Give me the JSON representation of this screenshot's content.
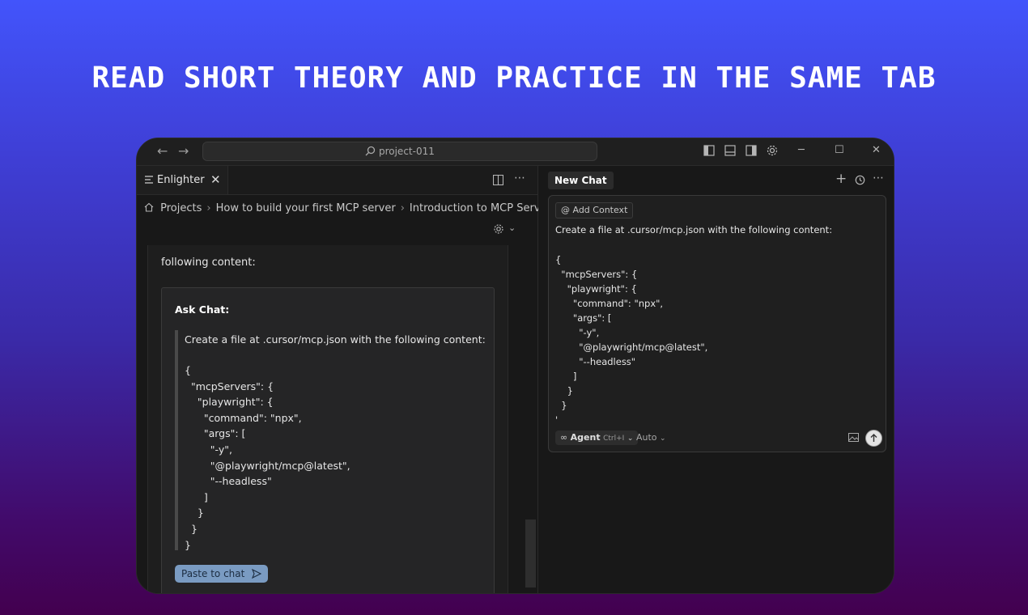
{
  "headline": "READ SHORT THEORY AND PRACTICE IN THE SAME TAB",
  "titlebar": {
    "search_text": "project-011",
    "back_icon": "arrow-left-icon",
    "forward_icon": "arrow-right-icon"
  },
  "left_pane": {
    "tab_label": "Enlighter",
    "breadcrumb": [
      "Projects",
      "How to build your first MCP server",
      "Introduction to MCP Servers"
    ],
    "doc_text": "following content:",
    "card": {
      "title": "Ask Chat:",
      "quote": "Create a file at .cursor/mcp.json with the following content:",
      "code_lines": [
        "{",
        "  \"mcpServers\": {",
        "    \"playwright\": {",
        "      \"command\": \"npx\",",
        "      \"args\": [",
        "        \"-y\",",
        "        \"@playwright/mcp@latest\",",
        "        \"--headless\"",
        "      ]",
        "    }",
        "  }",
        "}"
      ],
      "paste_label": "Paste to chat"
    }
  },
  "right_pane": {
    "chat_tab": "New Chat",
    "add_context": "@ Add Context",
    "message": "Create a file at .cursor/mcp.json with the following content:",
    "code_lines": [
      "{",
      "  \"mcpServers\": {",
      "    \"playwright\": {",
      "      \"command\": \"npx\",",
      "      \"args\": [",
      "        \"-y\",",
      "        \"@playwright/mcp@latest\",",
      "        \"--headless\"",
      "      ]",
      "    }",
      "  }",
      "'"
    ],
    "agent_label": "Agent",
    "agent_shortcut": "Ctrl+I",
    "model_label": "Auto"
  },
  "colors": {
    "bg_top": "#4254fb",
    "bg_bottom": "#43004f",
    "window": "#181818",
    "paste_button": "#7a9bc2"
  }
}
